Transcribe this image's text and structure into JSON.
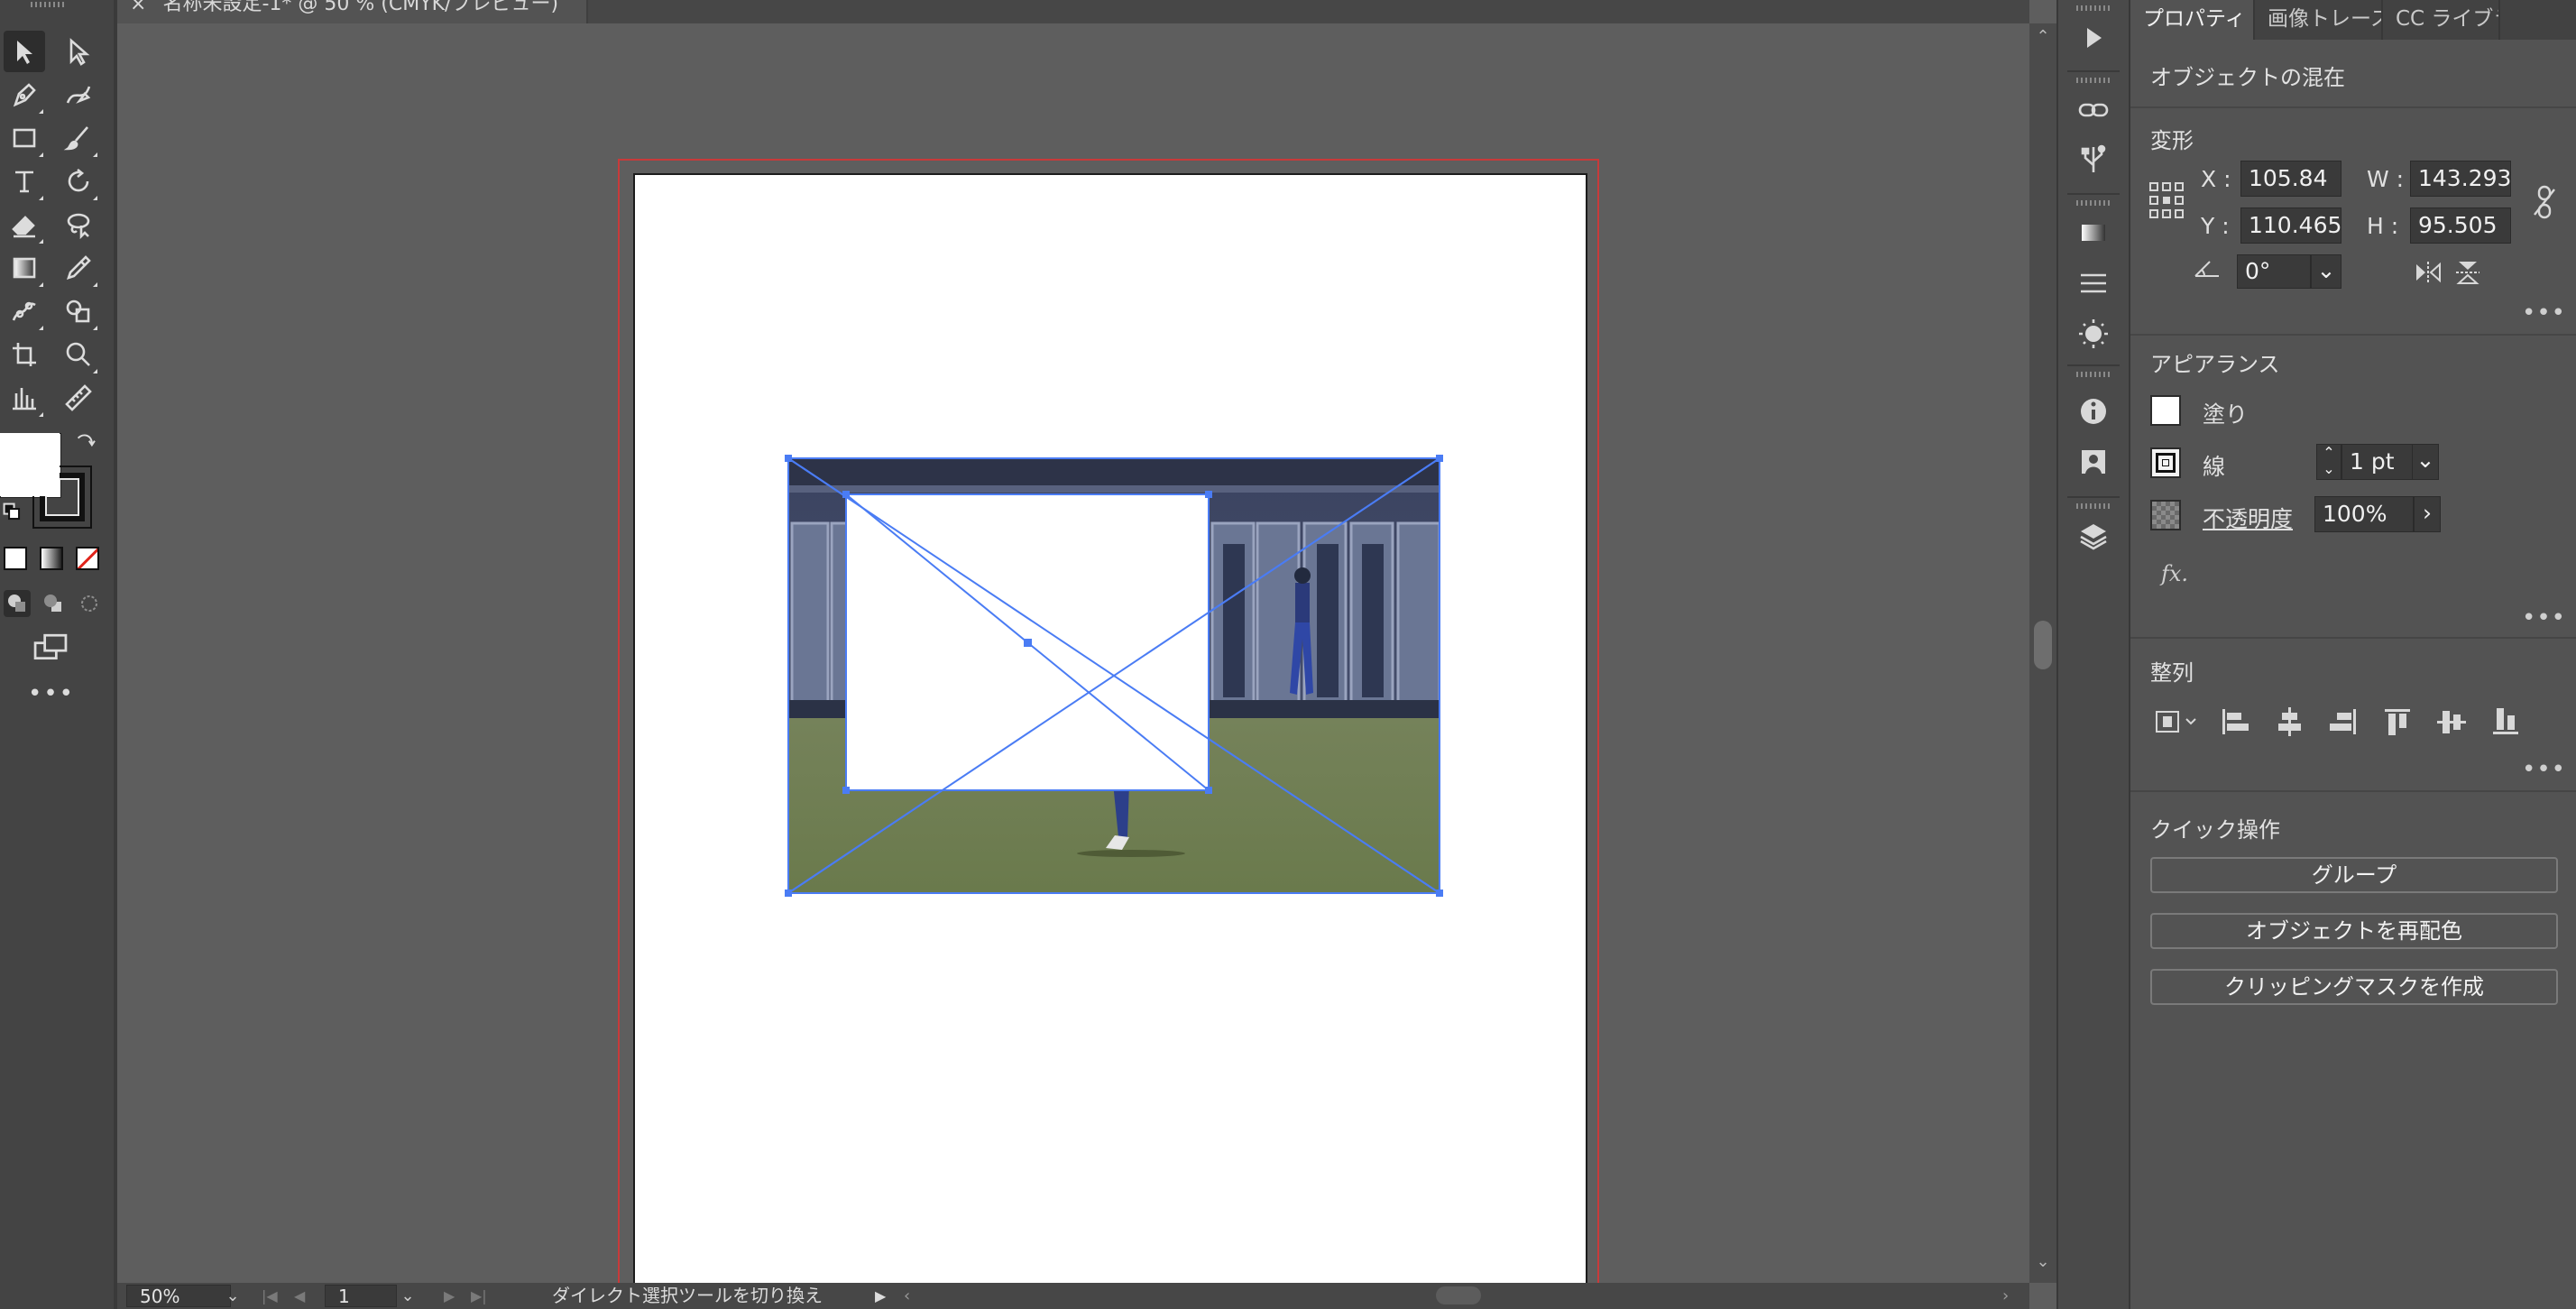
{
  "document": {
    "tab_close": "×",
    "tab_title": "名称未設定-1* @ 50 % (CMYK/プレビュー)"
  },
  "statusbar": {
    "zoom": "50%",
    "artboard_number": "1",
    "status_text": "ダイレクト選択ツールを切り換え"
  },
  "panel": {
    "tabs": [
      "プロパティ",
      "画像トレース",
      "CC ライブラリ"
    ],
    "selection_label": "オブジェクトの混在",
    "transform": {
      "title": "変形",
      "x_label": "X :",
      "x_value": "105.84",
      "y_label": "Y :",
      "y_value": "110.465",
      "w_label": "W :",
      "w_value": "143.293",
      "h_label": "H :",
      "h_value": "95.505",
      "angle_value": "0°"
    },
    "appearance": {
      "title": "アピアランス",
      "fill_label": "塗り",
      "stroke_label": "線",
      "stroke_value": "1 pt",
      "opacity_label": "不透明度",
      "opacity_value": "100%",
      "fx_label": "fx."
    },
    "align": {
      "title": "整列"
    },
    "quick_actions": {
      "title": "クイック操作",
      "group_button": "グループ",
      "recolor_button": "オブジェクトを再配色",
      "clip_button": "クリッピングマスクを作成"
    }
  },
  "colors": {
    "accent_selection": "#4a7cf4",
    "bleed_guide": "#c83a3a",
    "panel_bg": "#535353",
    "toolbar_bg": "#444444",
    "canvas_bg": "#5e5e5e"
  },
  "icons": {
    "toolbar": [
      "selection-tool-icon",
      "direct-selection-tool-icon",
      "pen-tool-icon",
      "curvature-tool-icon",
      "rectangle-tool-icon",
      "paintbrush-tool-icon",
      "type-tool-icon",
      "rotate-tool-icon",
      "eraser-tool-icon",
      "lasso-tool-icon",
      "gradient-tool-icon",
      "eyedropper-tool-icon",
      "puppet-warp-tool-icon",
      "shape-builder-tool-icon",
      "artboard-tool-icon",
      "zoom-tool-icon",
      "graph-tool-icon",
      "measure-tool-icon"
    ],
    "dock": [
      "play-icon",
      "link-icon",
      "usb-icon",
      "gradient-icon",
      "stroke-icon",
      "brightness-icon",
      "info-icon",
      "image-icon",
      "layers-icon"
    ]
  }
}
